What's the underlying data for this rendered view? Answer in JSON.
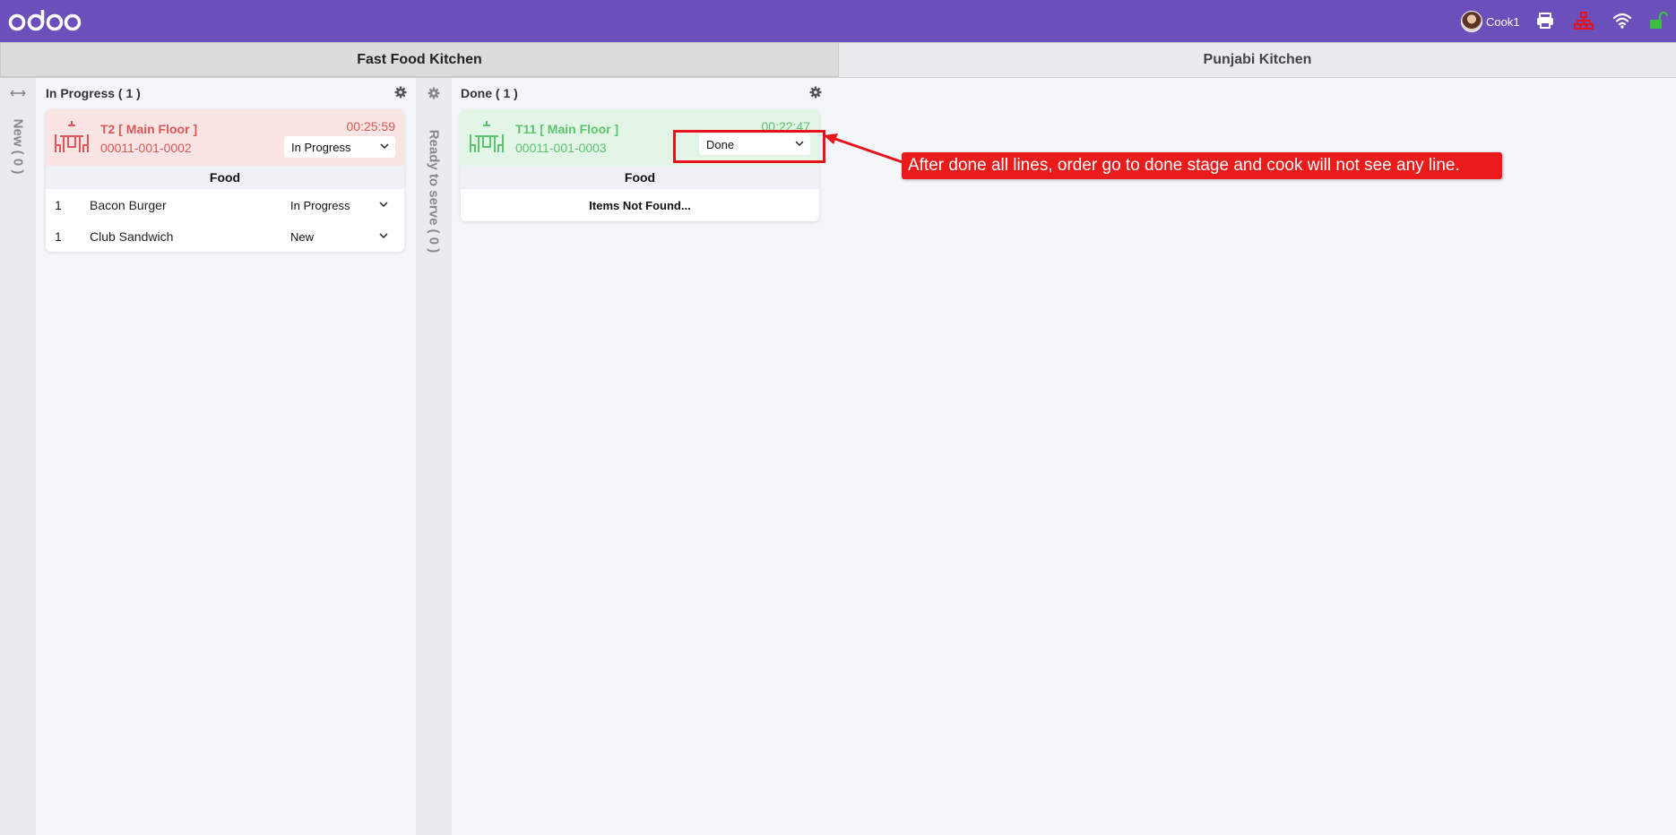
{
  "topbar": {
    "brand": "odoo",
    "user_name": "Cook1",
    "icons": [
      "printer-icon",
      "network-icon",
      "wifi-icon",
      "unlock-icon"
    ]
  },
  "tabs": [
    {
      "label": "Fast Food Kitchen",
      "active": true
    },
    {
      "label": "Punjabi Kitchen",
      "active": false
    }
  ],
  "columns": {
    "new": {
      "label": "New ( 0 )"
    },
    "in_progress": {
      "label": "In Progress ( 1 )",
      "order": {
        "title": "T2 [ Main Floor ]",
        "number": "00011-001-0002",
        "time": "00:25:59",
        "status": "In Progress",
        "section": "Food",
        "lines": [
          {
            "qty": "1",
            "name": "Bacon Burger",
            "status": "In Progress"
          },
          {
            "qty": "1",
            "name": "Club Sandwich",
            "status": "New"
          }
        ]
      }
    },
    "ready": {
      "label": "Ready to serve ( 0 )"
    },
    "done": {
      "label": "Done ( 1 )",
      "order": {
        "title": "T11 [ Main Floor ]",
        "number": "00011-001-0003",
        "time": "00:22:47",
        "status": "Done",
        "section": "Food",
        "empty_text": "Items Not Found..."
      }
    }
  },
  "annotation": {
    "text": "After done all lines, order go to done stage and cook will not see any line."
  },
  "colors": {
    "topbar": "#6b4fbb",
    "in_progress": "#e05656",
    "done": "#5bc46f",
    "annotation": "#ea1b1b"
  }
}
